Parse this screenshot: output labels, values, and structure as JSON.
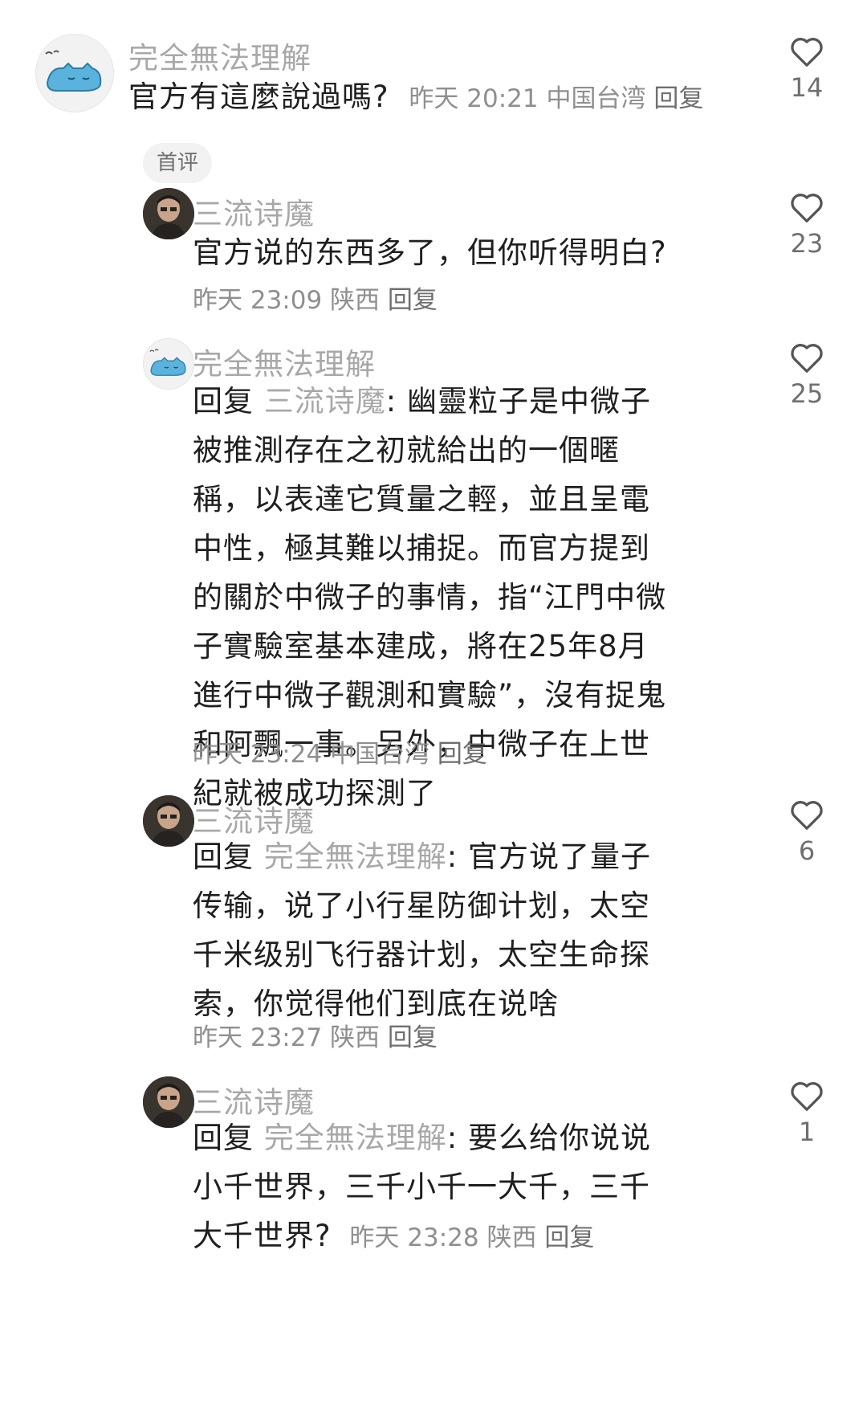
{
  "comments": [
    {
      "author": "完全無法理解",
      "text": "官方有這麼說過嗎?",
      "time": "昨天 20:21",
      "location": "中国台湾",
      "reply_label": "回复",
      "likes": "14",
      "badge": "首评"
    },
    {
      "author": "三流诗魔",
      "text": "官方说的东西多了，但你听得明白?",
      "time": "昨天 23:09",
      "location": "陕西",
      "reply_label": "回复",
      "likes": "23"
    },
    {
      "author": "完全無法理解",
      "reply_prefix": "回复",
      "reply_to": "三流诗魔",
      "text": ": 幽靈粒子是中微子被推測存在之初就給出的一個暱稱，以表達它質量之輕，並且呈電中性，極其難以捕捉。而官方提到的關於中微子的事情，指“江門中微子實驗室基本建成，將在25年8月進行中微子觀測和實驗”，沒有捉鬼和阿飄一事。另外，中微子在上世紀就被成功探測了",
      "time": "昨天 23:24",
      "location": "中国台湾",
      "reply_label": "回复",
      "likes": "25"
    },
    {
      "author": "三流诗魔",
      "reply_prefix": "回复",
      "reply_to": "完全無法理解",
      "text": ": 官方说了量子传输，说了小行星防御计划，太空千米级别飞行器计划，太空生命探索，你觉得他们到底在说啥",
      "time": "昨天 23:27",
      "location": "陕西",
      "reply_label": "回复",
      "likes": "6"
    },
    {
      "author": "三流诗魔",
      "reply_prefix": "回复",
      "reply_to": "完全無法理解",
      "text": ": 要么给你说说小千世界，三千小千一大千，三千大千世界?",
      "time": "昨天 23:28",
      "location": "陕西",
      "reply_label": "回复",
      "likes": "1"
    }
  ],
  "icons": {
    "like": "heart-outline-icon"
  }
}
